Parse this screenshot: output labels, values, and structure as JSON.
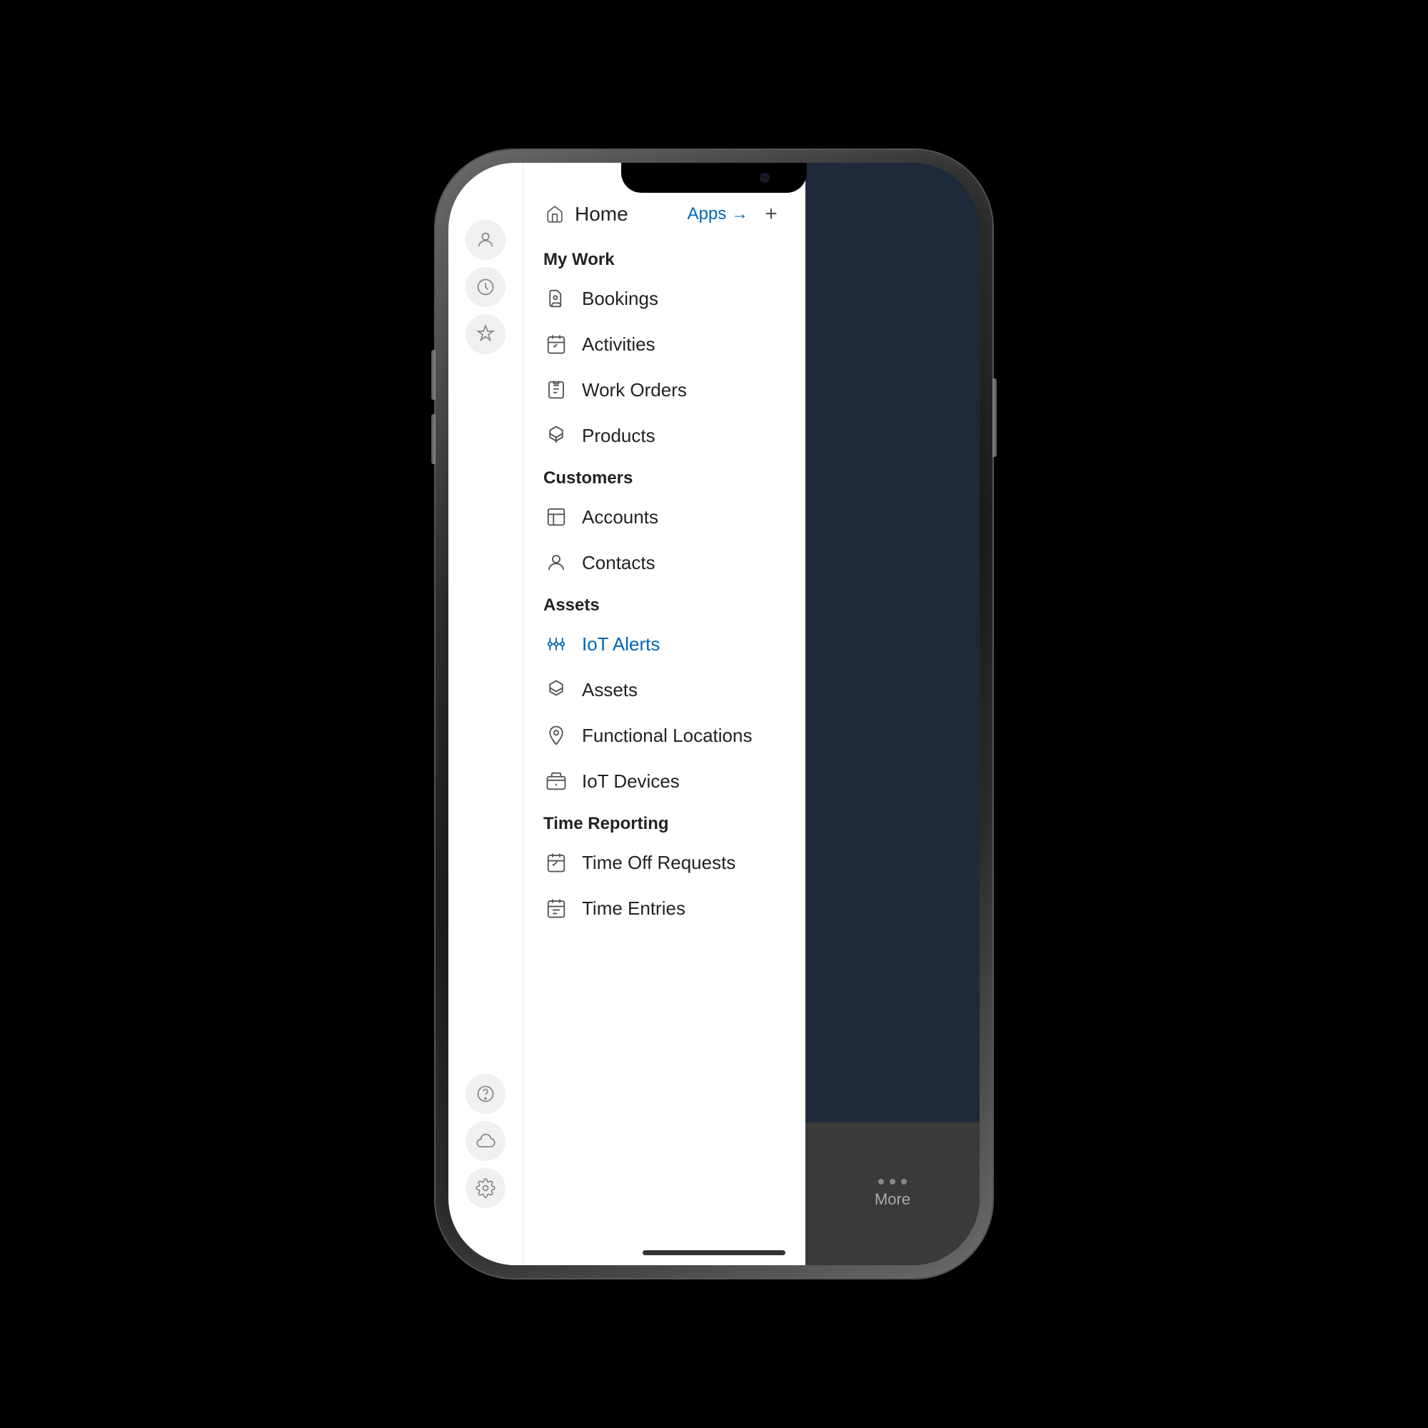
{
  "phone": {
    "sidebar": {
      "icons": [
        {
          "name": "user-icon",
          "label": "User"
        },
        {
          "name": "clock-icon",
          "label": "Recent"
        },
        {
          "name": "pin-icon",
          "label": "Pinned"
        }
      ],
      "bottom_icons": [
        {
          "name": "help-icon",
          "label": "Help"
        },
        {
          "name": "cloud-icon",
          "label": "Cloud"
        },
        {
          "name": "settings-icon",
          "label": "Settings"
        }
      ]
    },
    "menu": {
      "home_label": "Home",
      "apps_label": "Apps →",
      "add_label": "+",
      "sections": [
        {
          "header": "My Work",
          "header_key": "my_work_header",
          "items": [
            {
              "label": "Bookings",
              "icon": "bookings-icon",
              "active": false
            },
            {
              "label": "Activities",
              "icon": "activities-icon",
              "active": false
            },
            {
              "label": "Work Orders",
              "icon": "work-orders-icon",
              "active": false
            },
            {
              "label": "Products",
              "icon": "products-icon",
              "active": false
            }
          ]
        },
        {
          "header": "Customers",
          "header_key": "customers_header",
          "items": [
            {
              "label": "Accounts",
              "icon": "accounts-icon",
              "active": false
            },
            {
              "label": "Contacts",
              "icon": "contacts-icon",
              "active": false
            }
          ]
        },
        {
          "header": "Assets",
          "header_key": "assets_header",
          "items": [
            {
              "label": "IoT Alerts",
              "icon": "iot-alerts-icon",
              "active": true
            },
            {
              "label": "Assets",
              "icon": "assets-icon",
              "active": false
            },
            {
              "label": "Functional Locations",
              "icon": "functional-locations-icon",
              "active": false
            },
            {
              "label": "IoT Devices",
              "icon": "iot-devices-icon",
              "active": false
            }
          ]
        },
        {
          "header": "Time Reporting",
          "header_key": "time_reporting_header",
          "items": [
            {
              "label": "Time Off Requests",
              "icon": "time-off-requests-icon",
              "active": false
            },
            {
              "label": "Time Entries",
              "icon": "time-entries-icon",
              "active": false
            }
          ]
        }
      ]
    },
    "right_panel": {
      "more_label": "More"
    }
  }
}
